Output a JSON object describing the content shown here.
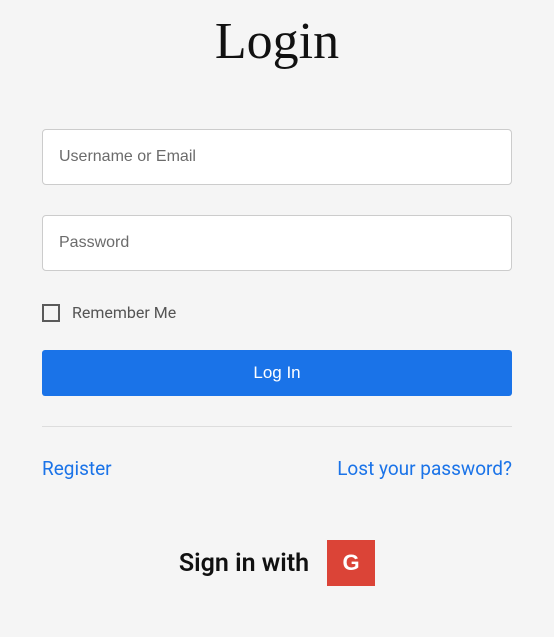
{
  "title": "Login",
  "fields": {
    "username_placeholder": "Username or Email",
    "password_placeholder": "Password"
  },
  "remember_label": "Remember Me",
  "login_button": "Log In",
  "links": {
    "register": "Register",
    "lost_password": "Lost your password?"
  },
  "social": {
    "label": "Sign in with",
    "google_glyph": "G"
  }
}
